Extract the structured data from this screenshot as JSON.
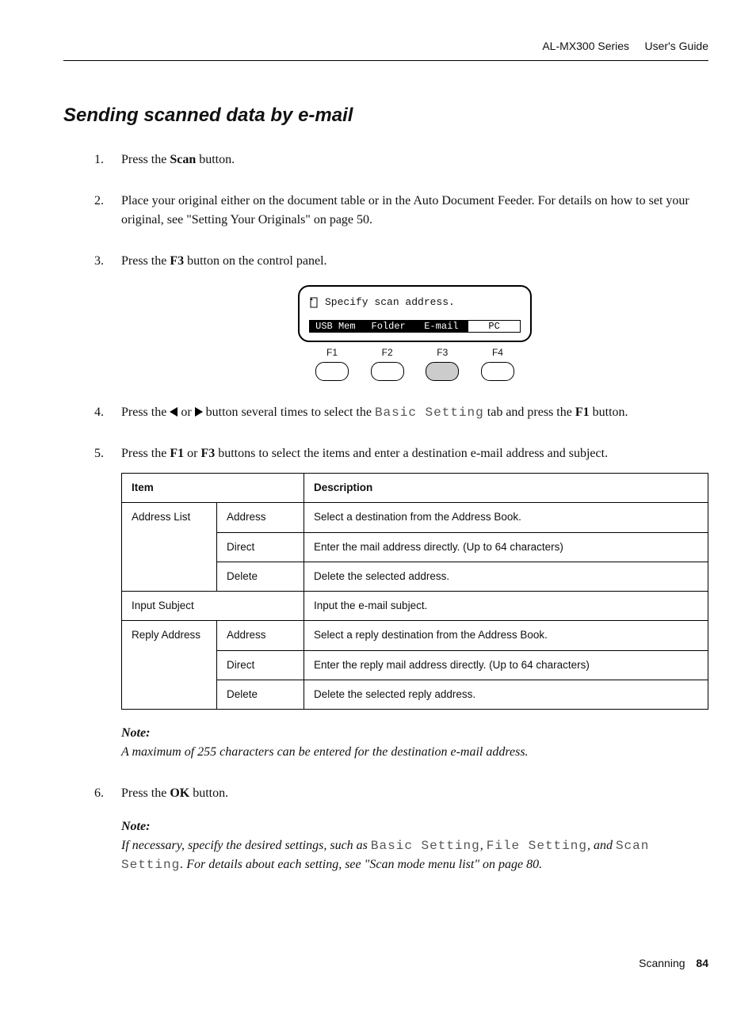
{
  "header": {
    "series": "AL-MX300 Series",
    "guide": "User's Guide"
  },
  "section_title": "Sending scanned data by e-mail",
  "steps": {
    "s1_pre": "Press the ",
    "s1_bold": "Scan",
    "s1_post": " button.",
    "s2": "Place your original either on the document table or in the Auto Document Feeder. For details on how to set your original, see \"Setting Your Originals\" on page 50.",
    "s3_pre": "Press the ",
    "s3_bold": "F3",
    "s3_post": " button on the control panel.",
    "s4_pre": "Press the ",
    "s4_mid": " or ",
    "s4_after_arrows": " button several times to select the ",
    "s4_mono": "Basic Setting",
    "s4_tab": " tab and press the ",
    "s4_bold": "F1",
    "s4_end": " button.",
    "s5_pre": "Press the ",
    "s5_b1": "F1",
    "s5_or": " or ",
    "s5_b2": "F3",
    "s5_post": " buttons to select the items and enter a destination e-mail address and subject.",
    "s6_pre": "Press the ",
    "s6_bold": "OK",
    "s6_post": " button."
  },
  "lcd": {
    "line1": "Specify scan address.",
    "tabs": [
      "USB Mem",
      "Folder",
      "E-mail",
      "PC"
    ],
    "fkeys": [
      "F1",
      "F2",
      "F3",
      "F4"
    ]
  },
  "table": {
    "headers": {
      "item": "Item",
      "desc": "Description"
    },
    "rows": {
      "address_list": "Address List",
      "al_address": "Address",
      "al_address_desc": "Select a destination from the Address Book.",
      "al_direct": "Direct",
      "al_direct_desc": "Enter the mail address directly. (Up to 64 characters)",
      "al_delete": "Delete",
      "al_delete_desc": "Delete the selected address.",
      "input_subject": "Input Subject",
      "input_subject_desc": "Input the e-mail subject.",
      "reply_address": "Reply Address",
      "ra_address": "Address",
      "ra_address_desc": "Select a reply destination from the Address Book.",
      "ra_direct": "Direct",
      "ra_direct_desc": "Enter the reply mail address directly. (Up to 64 characters)",
      "ra_delete": "Delete",
      "ra_delete_desc": "Delete the selected reply address."
    }
  },
  "notes": {
    "label": "Note:",
    "n1": "A maximum of 255 characters can be entered for the destination e-mail address.",
    "n2_pre": "If necessary, specify the desired settings, such as ",
    "n2_m1": "Basic Setting",
    "n2_c1": ", ",
    "n2_m2": "File Setting",
    "n2_c2": ", and ",
    "n2_m3": "Scan Setting",
    "n2_post": ". For details about each setting, see \"Scan mode menu list\" on page 80."
  },
  "footer": {
    "section": "Scanning",
    "page": "84"
  }
}
